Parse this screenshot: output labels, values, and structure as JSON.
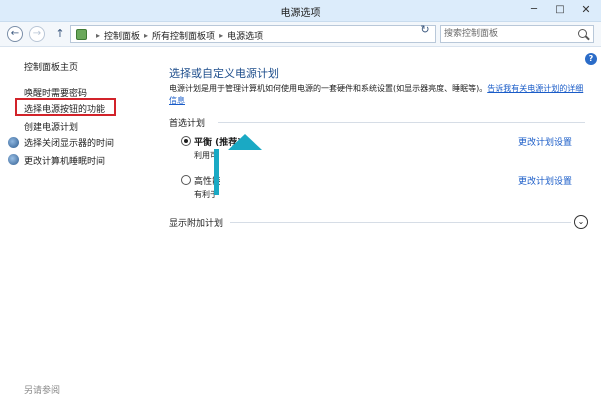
{
  "window": {
    "title": "电源选项",
    "min": "─",
    "max": "□",
    "close": "✕"
  },
  "nav": {
    "back": "←",
    "forward": "→",
    "up": "↑",
    "breadcrumbs": [
      "控制面板",
      "所有控制面板项",
      "电源选项"
    ],
    "separator": "▸",
    "dropdown": "▾",
    "refresh": "↻"
  },
  "search": {
    "placeholder": "搜索控制面板"
  },
  "help": "?",
  "sidebar": {
    "home": "控制面板主页",
    "items": [
      {
        "label": "唤醒时需要密码"
      },
      {
        "label": "选择电源按钮的功能"
      },
      {
        "label": "创建电源计划"
      },
      {
        "label": "选择关闭显示器的时间"
      },
      {
        "label": "更改计算机睡眠时间"
      }
    ],
    "see_also": "另请参阅"
  },
  "main": {
    "title": "选择或自定义电源计划",
    "description": "电源计划是用于管理计算机如何使用电源的一套硬件和系统设置(如显示器亮度、睡眠等)。",
    "description_link": "告诉我有关电源计划的详细信息",
    "preferred_section": "首选计划",
    "plans": [
      {
        "name": "平衡 (推荐)",
        "desc": "利用可",
        "change": "更改计划设置",
        "selected": true
      },
      {
        "name": "高性能",
        "desc": "有利于",
        "change": "更改计划设置",
        "selected": false
      }
    ],
    "additional_section": "显示附加计划",
    "expand": "⌄"
  },
  "colors": {
    "accent_link": "#1a5cc8",
    "highlight_box": "#d2232a",
    "arrow": "#1aa9c4"
  }
}
